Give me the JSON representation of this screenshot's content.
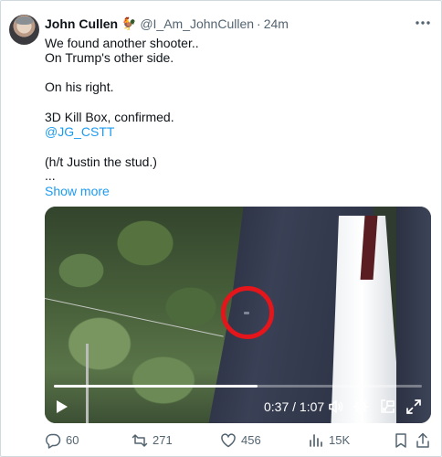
{
  "author": {
    "name": "John Cullen",
    "badge": "🐓",
    "handle": "@I_Am_JohnCullen",
    "separator": "·",
    "time": "24m"
  },
  "tweet": {
    "lines": [
      "We found another shooter..",
      "On Trump's other side.",
      "On his right.",
      "3D Kill Box, confirmed.",
      "(h/t Justin the stud.)",
      "..."
    ],
    "mention": "@JG_CSTT",
    "show_more": "Show more"
  },
  "video": {
    "timecode": "0:37 / 1:07",
    "progress": 0.553
  },
  "actions": {
    "replies": "60",
    "reposts": "271",
    "likes": "456",
    "views": "15K"
  },
  "colors": {
    "accent": "#1d9bf0",
    "secondary_text": "#536471",
    "highlight_circle": "#e4161b"
  }
}
